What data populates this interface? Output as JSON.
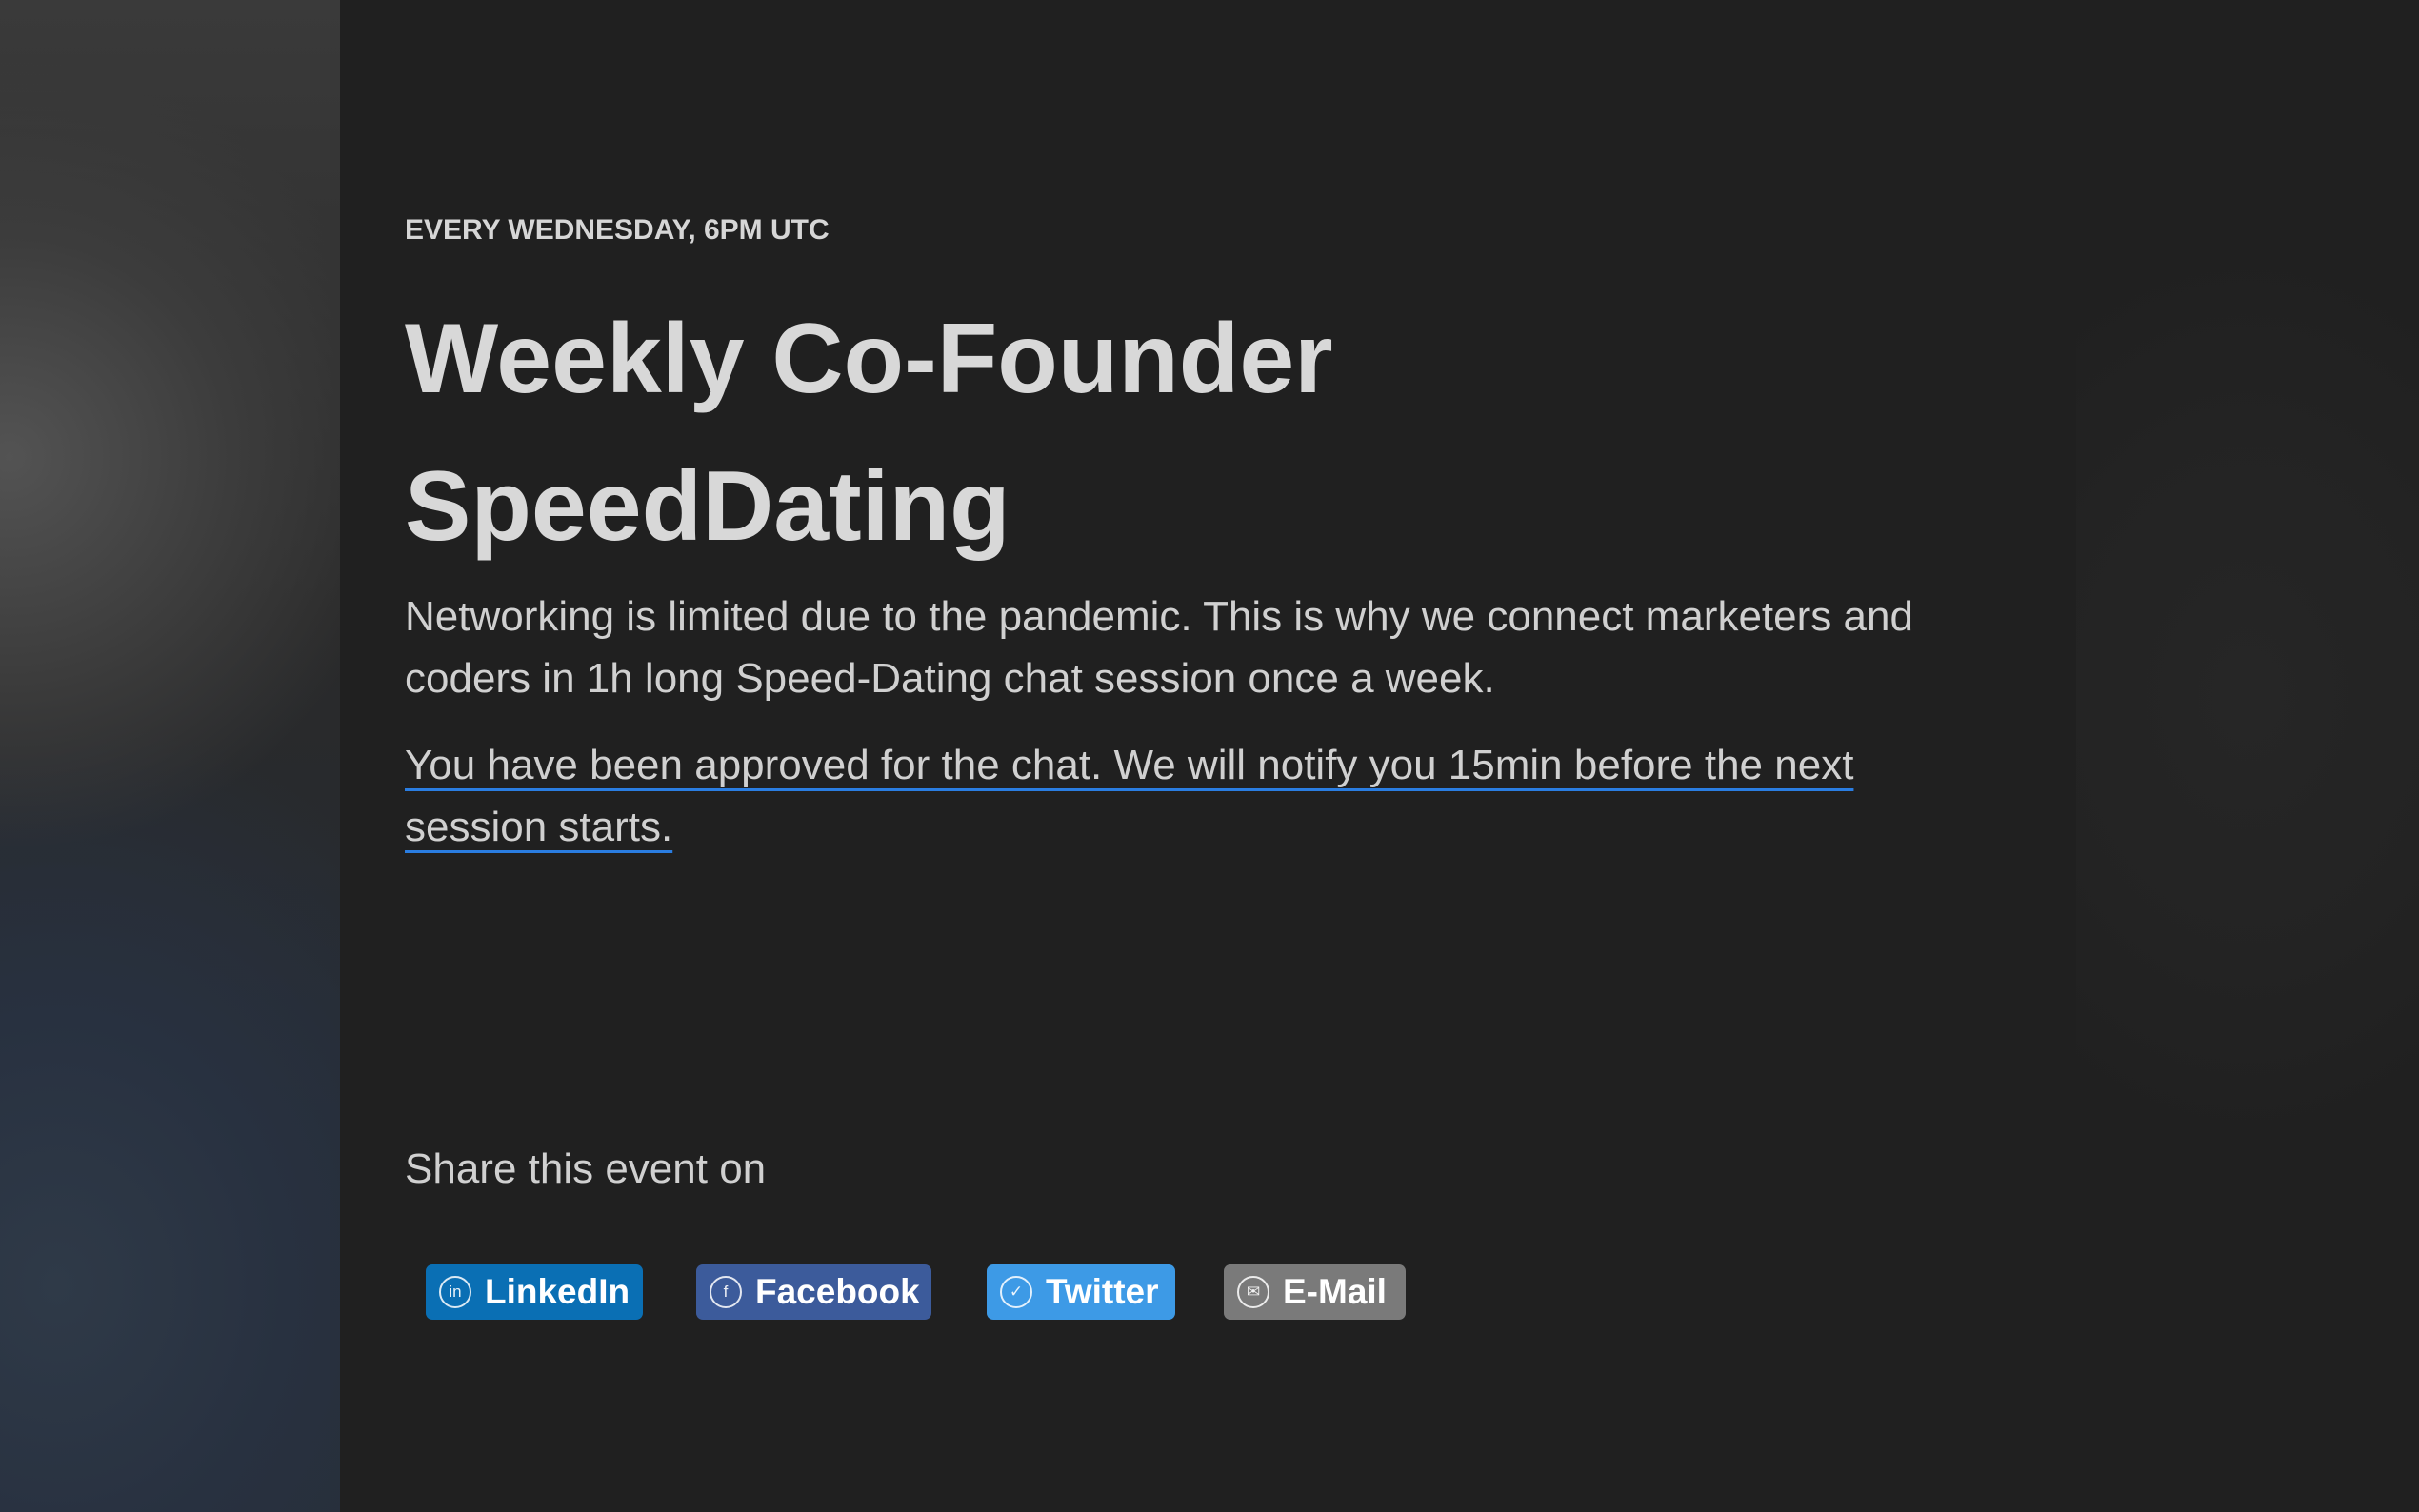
{
  "event": {
    "schedule": "EVERY WEDNESDAY, 6PM UTC",
    "title": "Weekly Co-Founder SpeedDating",
    "description": "Networking is limited due to the pandemic. This is why we connect marketers and coders in 1h long Speed-Dating chat session once a week.",
    "approval_message": "You have been approved for the chat. We will notify you 15min before the next session starts."
  },
  "share": {
    "label": "Share this event on",
    "buttons": [
      {
        "label": "LinkedIn",
        "icon": "linkedin-icon",
        "color": "#0a6fb4"
      },
      {
        "label": "Facebook",
        "icon": "facebook-icon",
        "color": "#3c5b9b"
      },
      {
        "label": "Twitter",
        "icon": "twitter-icon",
        "color": "#3d9ae6"
      },
      {
        "label": "E-Mail",
        "icon": "email-icon",
        "color": "#7a7a7a"
      }
    ]
  },
  "colors": {
    "background": "#202020",
    "text": "#d0d0d0",
    "link_underline": "#2a7de1"
  }
}
